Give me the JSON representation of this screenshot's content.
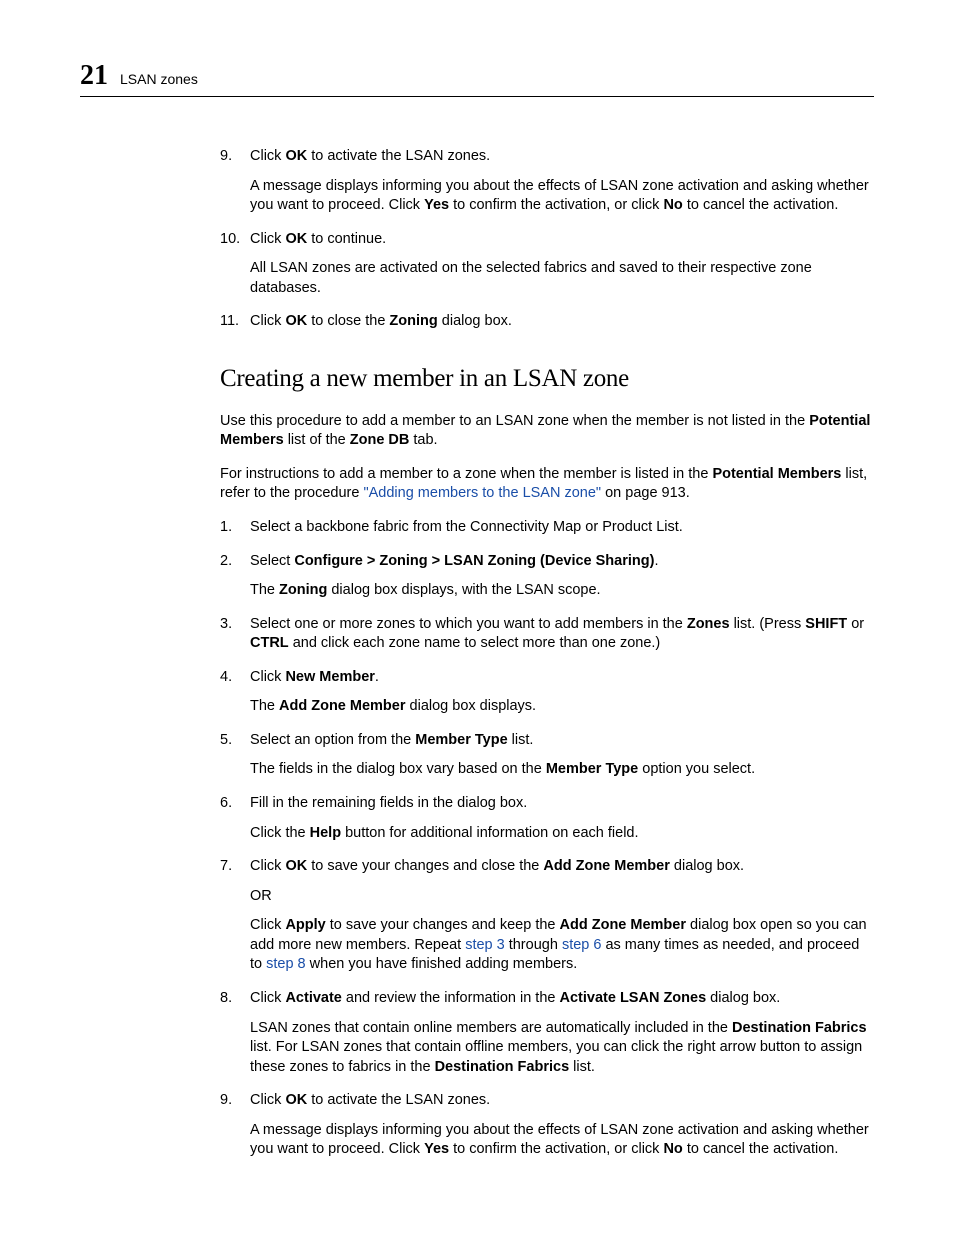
{
  "header": {
    "chapter": "21",
    "title": "LSAN zones"
  },
  "topSteps": {
    "s9num": "9.",
    "s9a": "Click ",
    "s9b": "OK",
    "s9c": " to activate the LSAN zones.",
    "s9sub_a": "A message displays informing you about the effects of LSAN zone activation and asking whether you want to proceed. Click ",
    "s9sub_b": "Yes",
    "s9sub_c": " to confirm the activation, or click ",
    "s9sub_d": "No",
    "s9sub_e": " to cancel the activation.",
    "s10num": "10.",
    "s10a": "Click ",
    "s10b": "OK",
    "s10c": " to continue.",
    "s10sub": "All LSAN zones are activated on the selected fabrics and saved to their respective zone databases.",
    "s11num": "11.",
    "s11a": "Click ",
    "s11b": "OK",
    "s11c": " to close the ",
    "s11d": "Zoning",
    "s11e": " dialog box."
  },
  "section": {
    "title": "Creating a new member in an LSAN zone",
    "p1a": "Use this procedure to add a member to an LSAN zone when the member is not listed in the ",
    "p1b": "Potential Members",
    "p1c": " list of the ",
    "p1d": "Zone DB",
    "p1e": " tab.",
    "p2a": "For instructions to add a member to a zone when the member is listed in the ",
    "p2b": "Potential Members",
    "p2c": " list, refer to the procedure ",
    "p2link": "\"Adding members to the LSAN zone\"",
    "p2d": " on page 913."
  },
  "steps": {
    "n1": "1.",
    "t1": "Select a backbone fabric from the Connectivity Map or Product List.",
    "n2": "2.",
    "t2a": "Select ",
    "t2b": "Configure > Zoning > LSAN Zoning (Device Sharing)",
    "t2c": ".",
    "t2sub_a": "The ",
    "t2sub_b": "Zoning",
    "t2sub_c": " dialog box displays, with the LSAN scope.",
    "n3": "3.",
    "t3a": "Select one or more zones to which you want to add members in the ",
    "t3b": "Zones",
    "t3c": " list. (Press ",
    "t3d": "SHIFT",
    "t3e": " or ",
    "t3f": "CTRL",
    "t3g": " and click each zone name to select more than one zone.)",
    "n4": "4.",
    "t4a": "Click ",
    "t4b": "New Member",
    "t4c": ".",
    "t4sub_a": "The ",
    "t4sub_b": "Add Zone Member",
    "t4sub_c": " dialog box displays.",
    "n5": "5.",
    "t5a": "Select an option from the ",
    "t5b": "Member Type",
    "t5c": " list.",
    "t5sub_a": "The fields in the dialog box vary based on the ",
    "t5sub_b": "Member Type",
    "t5sub_c": " option you select.",
    "n6": "6.",
    "t6": "Fill in the remaining fields in the dialog box.",
    "t6sub_a": "Click the ",
    "t6sub_b": "Help",
    "t6sub_c": " button for additional information on each field.",
    "n7": "7.",
    "t7a": "Click ",
    "t7b": "OK",
    "t7c": " to save your changes and close the ",
    "t7d": "Add Zone Member",
    "t7e": " dialog box.",
    "t7or": "OR",
    "t7sub_a": "Click ",
    "t7sub_b": "Apply",
    "t7sub_c": " to save your changes and keep the ",
    "t7sub_d": "Add Zone Member",
    "t7sub_e": " dialog box open so you can add more new members. Repeat ",
    "t7link1": "step 3",
    "t7sub_f": " through ",
    "t7link2": "step 6",
    "t7sub_g": " as many times as needed, and proceed to ",
    "t7link3": "step 8",
    "t7sub_h": " when you have finished adding members.",
    "n8": "8.",
    "t8a": "Click ",
    "t8b": "Activate",
    "t8c": " and review the information in the ",
    "t8d": "Activate LSAN Zones",
    "t8e": " dialog box.",
    "t8sub_a": "LSAN zones that contain online members are automatically included in the ",
    "t8sub_b": "Destination Fabrics",
    "t8sub_c": " list. For LSAN zones that contain offline members, you can click the right arrow button to assign these zones to fabrics in the ",
    "t8sub_d": "Destination Fabrics",
    "t8sub_e": " list.",
    "n9": "9.",
    "t9a": "Click ",
    "t9b": "OK",
    "t9c": " to activate the LSAN zones.",
    "t9sub_a": "A message displays informing you about the effects of LSAN zone activation and asking whether you want to proceed. Click ",
    "t9sub_b": "Yes",
    "t9sub_c": " to confirm the activation, or click ",
    "t9sub_d": "No",
    "t9sub_e": " to cancel the activation."
  }
}
